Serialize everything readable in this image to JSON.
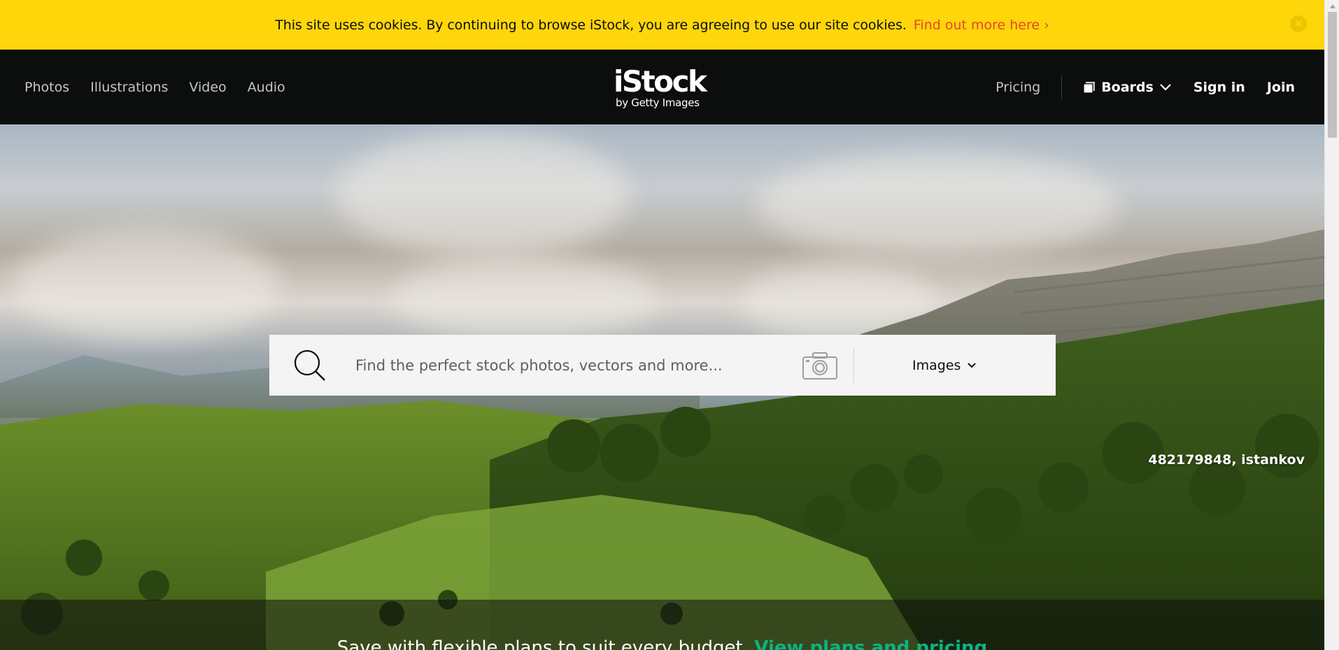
{
  "cookie_banner": {
    "text": "This site uses cookies. By continuing to browse iStock, you are agreeing to use our site cookies.",
    "link_label": "Find out more here ›",
    "close_icon": "close-icon"
  },
  "nav": {
    "left_links": [
      "Photos",
      "Illustrations",
      "Video",
      "Audio"
    ],
    "logo": {
      "main": "iStock",
      "sub": "by Getty Images"
    },
    "pricing_label": "Pricing",
    "boards_label": "Boards",
    "signin_label": "Sign in",
    "join_label": "Join"
  },
  "search": {
    "placeholder": "Find the perfect stock photos, vectors and more...",
    "value": "",
    "media_type": "Images",
    "search_icon": "search-icon",
    "camera_icon": "camera-icon"
  },
  "hero": {
    "credit": "482179848, istankov"
  },
  "promo": {
    "text": "Save with flexible plans to suit every budget.",
    "link_label": "View plans and pricing"
  },
  "colors": {
    "banner_yellow": "#ffd60a",
    "link_red": "#e8452a",
    "nav_bg": "#0c0d0d",
    "promo_green": "#0ab383"
  }
}
